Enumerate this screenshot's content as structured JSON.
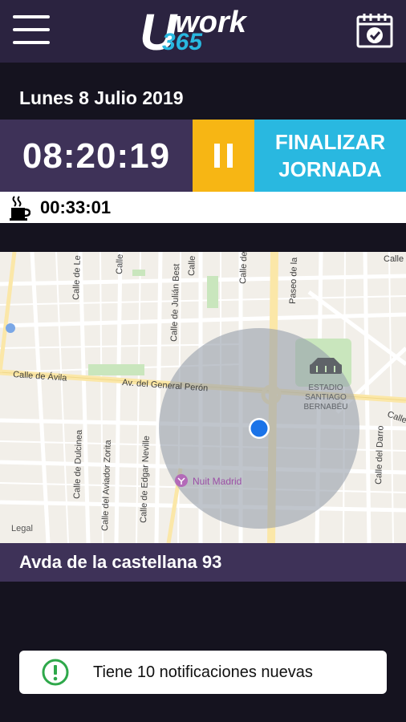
{
  "header": {
    "logo_text": "Uwork",
    "logo_sub": "365",
    "menu_icon": "hamburger-menu-icon",
    "calendar_icon": "calendar-check-icon"
  },
  "date": "Lunes 8 Julio 2019",
  "shift": {
    "elapsed": "08:20:19",
    "pause_icon": "pause-icon",
    "finish_line1": "FINALIZAR",
    "finish_line2": "JORNADA"
  },
  "break": {
    "icon": "coffee-cup-icon",
    "elapsed": "00:33:01"
  },
  "map": {
    "streets": {
      "avila": "Calle de Ávila",
      "general_peron": "Av. del General Perón",
      "paseo": "Paseo de la",
      "dulcinea": "Calle de Dulcinea",
      "aviador_zorita": "Calle del Aviador Zorita",
      "edgar_neville": "Calle de Edgar Neville",
      "julian_besteiro": "Calle de Julián Best",
      "calle_de": "Calle de",
      "calle_top1": "Calle de Le",
      "calle_top2": "Calle",
      "calle_top3": "Calle",
      "darro": "Calle del Darro",
      "calle_right": "Calle",
      "calle_right2": "Calle"
    },
    "stadium_line1": "ESTADIO",
    "stadium_line2": "SANTIAGO",
    "stadium_line3": "BERNABÉU",
    "poi": "Nuit Madrid",
    "legal": "Legal",
    "colors": {
      "land": "#f2efe9",
      "accuracy": "#9aa1ad",
      "dot": "#1a73e8",
      "park": "#c9e6bd"
    }
  },
  "address": "Avda de la castellana 93",
  "notification": {
    "icon": "exclamation-circle-icon",
    "text": "Tiene 10 notificaciones nuevas"
  },
  "colors": {
    "background": "#15131f",
    "topbar": "#2b2340",
    "purple": "#3e3258",
    "pause": "#f7b614",
    "finish": "#29b8e0",
    "notice_green": "#2ea84a",
    "logo_blue": "#29b8e0"
  }
}
